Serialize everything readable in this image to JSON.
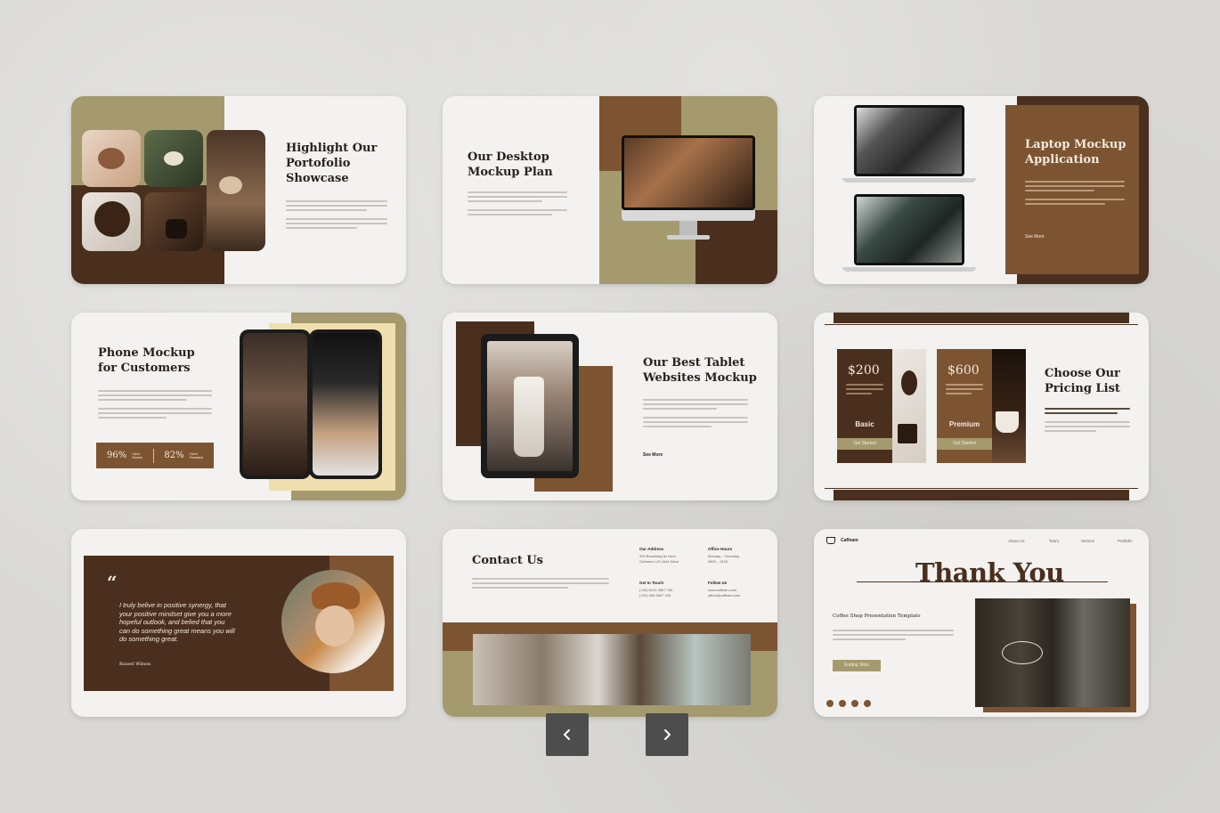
{
  "colors": {
    "dark_brown": "#4a2f1e",
    "olive": "#a59a6e",
    "caramel": "#7d5431",
    "cream": "#f3f2f0",
    "light_cream": "#f0dfae",
    "nav_bg": "#4d4d4d"
  },
  "slides": {
    "s1": {
      "title_l1": "Highlight Our",
      "title_l2": "Portofolio",
      "title_l3": "Showcase"
    },
    "s2": {
      "title_l1": "Our Desktop",
      "title_l2": "Mockup Plan"
    },
    "s3": {
      "title_l1": "Laptop Mockup",
      "title_l2": "Application",
      "link": "See More"
    },
    "s4": {
      "title_l1": "Phone Mockup",
      "title_l2": "for Customers",
      "stat1": "96%",
      "stat1_label_l1": "Client",
      "stat1_label_l2": "Review",
      "stat2": "82%",
      "stat2_label_l1": "Client",
      "stat2_label_l2": "Feedback"
    },
    "s5": {
      "title_l1": "Our Best Tablet",
      "title_l2": "Websites Mockup",
      "link": "See More"
    },
    "s6": {
      "title_l1": "Choose Our",
      "title_l2": "Pricing List",
      "plan1_price": "$200",
      "plan1_name": "Basic",
      "plan1_btn": "Get Started",
      "plan2_price": "$600",
      "plan2_name": "Premium",
      "plan2_btn": "Get Started"
    },
    "s7": {
      "quote_mark": "“",
      "quote_l1": "I truly belive in positive synergy, that",
      "quote_l2": "your positive mindset give you a more",
      "quote_l3": "hopeful outlook, and belied that you",
      "quote_l4": "can do something great means you will",
      "quote_l5": "do something great.",
      "author": "Russel Wilson"
    },
    "s8": {
      "title": "Contact Us",
      "address_head": "Our Address",
      "address_l1": "333 Broadway Av Hero",
      "address_l2": "Gotham's US 4444 West",
      "hours_head": "Office Hours",
      "hours_l1": "Monday – Thursday",
      "hours_l2": "0800 – 2100",
      "touch_head": "Get In Touch",
      "touch_l1": "(+62) 8123 4567 789",
      "touch_l2": "(+62) 456 9847 153",
      "follow_head": "Follow Us",
      "follow_l1": "www.caffeam.com",
      "follow_l2": "office@caffeam.com"
    },
    "s9": {
      "brand": "Caffeam",
      "nav": [
        "About Us",
        "Team",
        "Service",
        "Portfolio"
      ],
      "title": "Thank You",
      "subtitle": "Coffee Shop Presentation Template",
      "button": "Ending Slide"
    }
  },
  "navigation": {
    "prev_icon": "chevron-left-icon",
    "next_icon": "chevron-right-icon"
  }
}
